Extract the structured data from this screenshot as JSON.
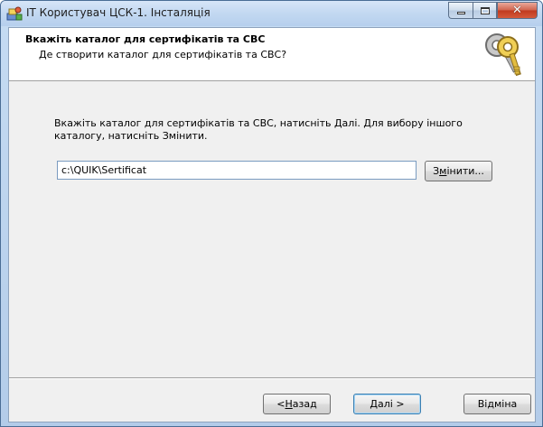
{
  "window": {
    "title": "ІТ Користувач ЦСК-1. Інсталяція"
  },
  "header": {
    "title": "Вкажіть каталог для сертифікатів та СВС",
    "subtitle": "Де створити каталог для сертифікатів та СВС?"
  },
  "body": {
    "description": "Вкажіть каталог для сертифікатів та СВС, натисніть Далі. Для вибору іншого каталогу, натисніть Змінити.",
    "path_value": "c:\\QUIK\\Sertificat"
  },
  "buttons": {
    "change_pre": "З",
    "change_mnemonic": "м",
    "change_post": "інити...",
    "back_pre": "< ",
    "back_mnemonic": "Н",
    "back_post": "азад",
    "next_mnemonic": "Д",
    "next_post": "алі >",
    "cancel": "Відміна"
  },
  "colors": {
    "titlebar": "#c2d8f1",
    "close_button": "#c0391e",
    "dialog_bg": "#f0f0f0",
    "default_button_border": "#3c7fb1"
  },
  "icons": {
    "app": "installer-app-icon",
    "header": "keys-icon"
  }
}
